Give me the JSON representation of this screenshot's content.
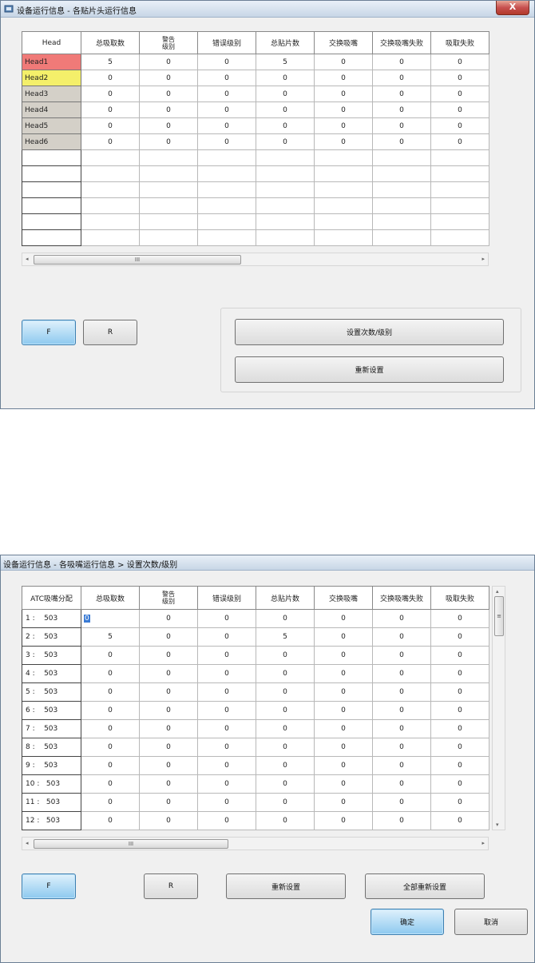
{
  "window1": {
    "title": "设备运行信息 - 各贴片头运行信息",
    "close_label": "X",
    "columns": [
      "Head",
      "总吸取数",
      "警告级别",
      "错误级别",
      "总贴片数",
      "交换吸嘴",
      "交换吸嘴失败",
      "吸取失败"
    ],
    "rows": [
      {
        "label": "Head1",
        "values": [
          "5",
          "0",
          "0",
          "5",
          "0",
          "0",
          "0"
        ]
      },
      {
        "label": "Head2",
        "values": [
          "0",
          "0",
          "0",
          "0",
          "0",
          "0",
          "0"
        ]
      },
      {
        "label": "Head3",
        "values": [
          "0",
          "0",
          "0",
          "0",
          "0",
          "0",
          "0"
        ]
      },
      {
        "label": "Head4",
        "values": [
          "0",
          "0",
          "0",
          "0",
          "0",
          "0",
          "0"
        ]
      },
      {
        "label": "Head5",
        "values": [
          "0",
          "0",
          "0",
          "0",
          "0",
          "0",
          "0"
        ]
      },
      {
        "label": "Head6",
        "values": [
          "0",
          "0",
          "0",
          "0",
          "0",
          "0",
          "0"
        ]
      }
    ],
    "empty_rows": 6,
    "scroll_thumb": "III",
    "buttons": {
      "f": "F",
      "r": "R",
      "set_count_level": "设置次数/级别",
      "reset": "重新设置"
    },
    "colors": {
      "head1": "#f07a78",
      "head2": "#f4ef6a"
    }
  },
  "window2": {
    "title": "设备运行信息 - 各吸嘴运行信息 > 设置次数/级别",
    "columns": [
      "ATC吸嘴分配",
      "总吸取数",
      "警告级别",
      "错误级别",
      "总贴片数",
      "交换吸嘴",
      "交换吸嘴失败",
      "吸取失败"
    ],
    "rows": [
      {
        "label": "1 :    503",
        "values": [
          "0",
          "0",
          "0",
          "0",
          "0",
          "0",
          "0"
        ]
      },
      {
        "label": "2 :    503",
        "values": [
          "5",
          "0",
          "0",
          "5",
          "0",
          "0",
          "0"
        ]
      },
      {
        "label": "3 :    503",
        "values": [
          "0",
          "0",
          "0",
          "0",
          "0",
          "0",
          "0"
        ]
      },
      {
        "label": "4 :    503",
        "values": [
          "0",
          "0",
          "0",
          "0",
          "0",
          "0",
          "0"
        ]
      },
      {
        "label": "5 :    503",
        "values": [
          "0",
          "0",
          "0",
          "0",
          "0",
          "0",
          "0"
        ]
      },
      {
        "label": "6 :    503",
        "values": [
          "0",
          "0",
          "0",
          "0",
          "0",
          "0",
          "0"
        ]
      },
      {
        "label": "7 :    503",
        "values": [
          "0",
          "0",
          "0",
          "0",
          "0",
          "0",
          "0"
        ]
      },
      {
        "label": "8 :    503",
        "values": [
          "0",
          "0",
          "0",
          "0",
          "0",
          "0",
          "0"
        ]
      },
      {
        "label": "9 :    503",
        "values": [
          "0",
          "0",
          "0",
          "0",
          "0",
          "0",
          "0"
        ]
      },
      {
        "label": "10 :   503",
        "values": [
          "0",
          "0",
          "0",
          "0",
          "0",
          "0",
          "0"
        ]
      },
      {
        "label": "11 :   503",
        "values": [
          "0",
          "0",
          "0",
          "0",
          "0",
          "0",
          "0"
        ]
      },
      {
        "label": "12 :   503",
        "values": [
          "0",
          "0",
          "0",
          "0",
          "0",
          "0",
          "0"
        ]
      }
    ],
    "scroll_thumb": "III",
    "vscroll_thumb": "≡",
    "buttons": {
      "f": "F",
      "r": "R",
      "reset": "重新设置",
      "reset_all": "全部重新设置",
      "ok": "确定",
      "cancel": "取消"
    }
  }
}
